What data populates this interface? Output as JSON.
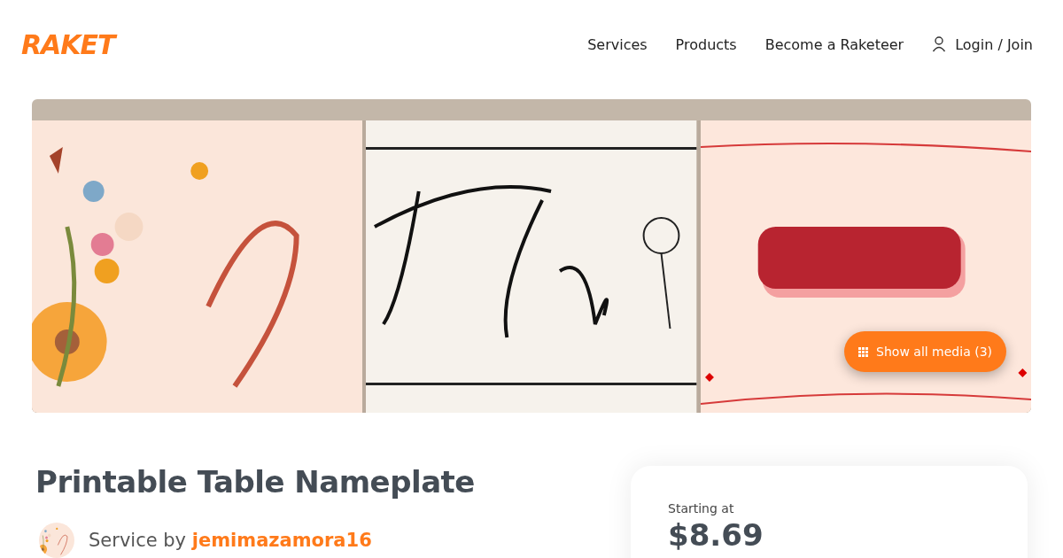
{
  "header": {
    "logo": "RAKET",
    "nav": [
      {
        "label": "Services"
      },
      {
        "label": "Products"
      },
      {
        "label": "Become a Raketeer"
      },
      {
        "label": "Login / Join",
        "kind": "account"
      }
    ]
  },
  "gallery": {
    "show_all_button": "Show all media (3)"
  },
  "service": {
    "title": "Printable Table Nameplate",
    "by_label": "Service by",
    "seller": "jemimazamora16"
  },
  "price_card": {
    "label": "Starting at",
    "price": "$8.69"
  }
}
